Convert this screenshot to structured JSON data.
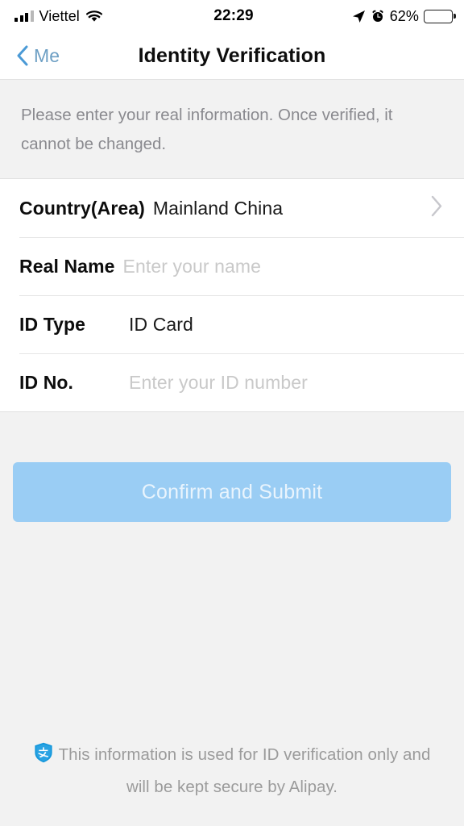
{
  "status_bar": {
    "carrier": "Viettel",
    "time": "22:29",
    "battery_percent": "62%",
    "battery_level": 62,
    "signal_bars_filled": 3,
    "signal_bars_total": 4,
    "icons": [
      "signal-bars-icon",
      "wifi-icon",
      "location-arrow-icon",
      "alarm-clock-icon",
      "battery-icon"
    ]
  },
  "nav": {
    "back_label": "Me",
    "title": "Identity Verification"
  },
  "notice": {
    "text": "Please enter your real information. Once verified, it cannot be changed."
  },
  "form": {
    "rows": [
      {
        "label": "Country(Area)",
        "value": "Mainland China",
        "is_placeholder": false,
        "has_chevron": true,
        "layout": "inline"
      },
      {
        "label": "Real Name",
        "value": "Enter your name",
        "is_placeholder": true,
        "has_chevron": false,
        "layout": "inline"
      },
      {
        "label": "ID Type",
        "value": "ID Card",
        "is_placeholder": false,
        "has_chevron": false,
        "layout": "columnar"
      },
      {
        "label": "ID No.",
        "value": "Enter your ID number",
        "is_placeholder": true,
        "has_chevron": false,
        "layout": "columnar"
      }
    ]
  },
  "submit": {
    "label": "Confirm and Submit",
    "enabled": false
  },
  "footer": {
    "text": "This information is used for ID verification only and will be kept secure by Alipay."
  },
  "colors": {
    "accent_blue": "#6d9fc4",
    "button_blue": "#9acdf4",
    "shield_blue": "#1296db",
    "page_background": "#f2f2f2",
    "card_background": "#ffffff",
    "placeholder_gray": "#c9c9c9",
    "muted_text": "#8a8a8f"
  }
}
